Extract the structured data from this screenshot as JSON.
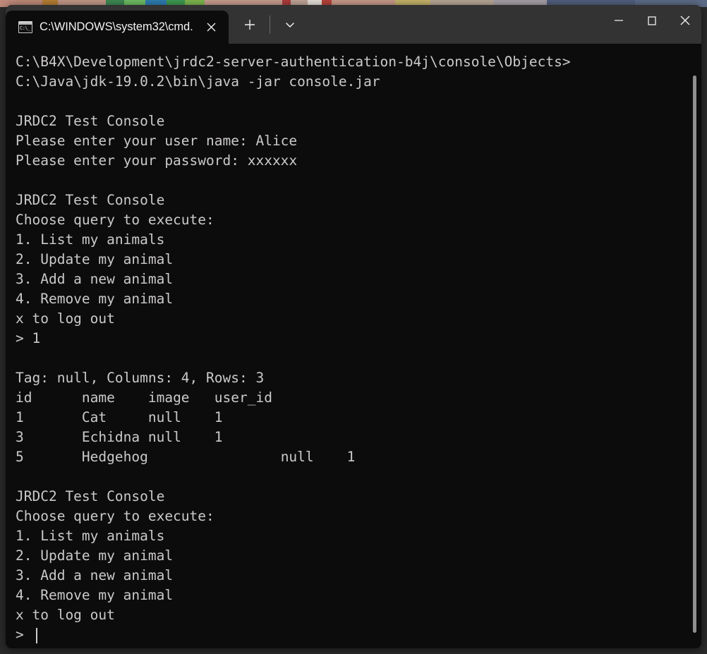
{
  "window": {
    "title": "C:\\WINDOWS\\system32\\cmd.",
    "tab_icon": "cmd-console-icon",
    "close_tab_icon": "close-icon",
    "new_tab_icon": "plus-icon",
    "dropdown_icon": "chevron-down-icon",
    "minimize_icon": "minimize-icon",
    "maximize_icon": "maximize-icon",
    "close_icon": "close-icon",
    "colors": {
      "titlebar_bg": "#333333",
      "terminal_bg": "#0c0c0c",
      "terminal_fg": "#ccc9c9",
      "scrollbar_thumb": "#8f8f8f"
    }
  },
  "tab_icon_glyph": "C:\\_",
  "terminal": {
    "lines": [
      "C:\\B4X\\Development\\jrdc2-server-authentication-b4j\\console\\Objects>",
      "C:\\Java\\jdk-19.0.2\\bin\\java -jar console.jar",
      "",
      "JRDC2 Test Console",
      "Please enter your user name: Alice",
      "Please enter your password: xxxxxx",
      "",
      "JRDC2 Test Console",
      "Choose query to execute:",
      "1. List my animals",
      "2. Update my animal",
      "3. Add a new animal",
      "4. Remove my animal",
      "x to log out",
      "> 1",
      "",
      "Tag: null, Columns: 4, Rows: 3",
      "id\tname\timage\tuser_id",
      "1\tCat\tnull\t1",
      "3\tEchidna\tnull\t1",
      "5\tHedgehog\t\tnull\t1",
      "",
      "JRDC2 Test Console",
      "Choose query to execute:",
      "1. List my animals",
      "2. Update my animal",
      "3. Add a new animal",
      "4. Remove my animal",
      "x to log out",
      "> "
    ],
    "prompt_cursor": "text-cursor",
    "session": {
      "working_directory": "C:\\B4X\\Development\\jrdc2-server-authentication-b4j\\console\\Objects",
      "command": "C:\\Java\\jdk-19.0.2\\bin\\java -jar console.jar",
      "app_title": "JRDC2 Test Console",
      "username_prompt": "Please enter your user name: ",
      "username_value": "Alice",
      "password_prompt": "Please enter your password: ",
      "password_value": "xxxxxx",
      "menu_header": "Choose query to execute:",
      "menu_options": [
        "1. List my animals",
        "2. Update my animal",
        "3. Add a new animal",
        "4. Remove my animal",
        "x to log out"
      ],
      "selected_option": "1",
      "result_summary": "Tag: null, Columns: 4, Rows: 3",
      "result_columns": [
        "id",
        "name",
        "image",
        "user_id"
      ],
      "result_rows": [
        [
          "1",
          "Cat",
          "null",
          "1"
        ],
        [
          "3",
          "Echidna",
          "null",
          "1"
        ],
        [
          "5",
          "Hedgehog",
          "null",
          "1"
        ]
      ],
      "prompt_symbol": ">"
    }
  }
}
